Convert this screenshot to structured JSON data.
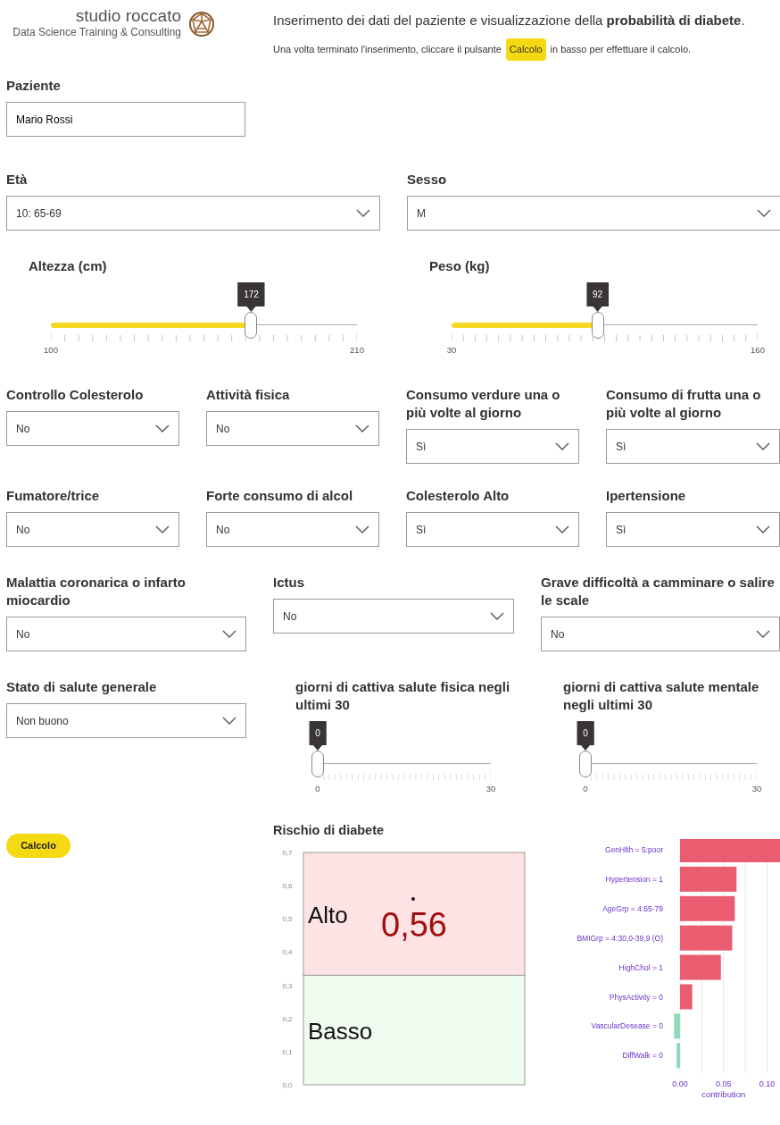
{
  "header": {
    "logo_title": "studio roccato",
    "logo_subtitle": "Data Science Training & Consulting",
    "headline": "Inserimento dei dati del paziente e visualizzazione della **probabilità di diabete**.",
    "instruction_before": "Una volta terminato l'inserimento, cliccare il pulsante",
    "instruction_button": "Calcolo",
    "instruction_after": "in basso per effettuare il calcolo."
  },
  "patient": {
    "label": "Paziente",
    "value": "Mario Rossi"
  },
  "rows": [
    {
      "fields": [
        {
          "kind": "select",
          "label": "Età",
          "value": "10: 65-69"
        },
        {
          "kind": "select",
          "label": "Sesso",
          "value": "M"
        }
      ]
    },
    {
      "fields": [
        {
          "kind": "slider",
          "label": "Altezza (cm)",
          "value": "172",
          "min": "100",
          "max": "210",
          "level": 0.6545
        },
        {
          "kind": "slider",
          "label": "Peso (kg)",
          "value": "92",
          "min": "30",
          "max": "160",
          "level": 0.4769
        }
      ]
    },
    {
      "fields": [
        {
          "kind": "select",
          "label": "Controllo Colesterolo",
          "value": "No"
        },
        {
          "kind": "select",
          "label": "Attività fisica",
          "value": "No"
        },
        {
          "kind": "select",
          "label": "Consumo verdure una o più volte al giorno",
          "value": "Sì"
        },
        {
          "kind": "select",
          "label": "Consumo di frutta una o più volte al giorno",
          "value": "Sì"
        }
      ]
    },
    {
      "fields": [
        {
          "kind": "select",
          "label": "Fumatore/trice",
          "value": "No"
        },
        {
          "kind": "select",
          "label": "Forte consumo di alcol",
          "value": "No"
        },
        {
          "kind": "select",
          "label": "Colesterolo Alto",
          "value": "Sì"
        },
        {
          "kind": "select",
          "label": "Ipertensione",
          "value": "Sì"
        }
      ]
    },
    {
      "fields": [
        {
          "kind": "select",
          "label": "Malattia coronarica o infarto miocardio",
          "value": "No"
        },
        {
          "kind": "select",
          "label": "Ictus",
          "value": "No"
        },
        {
          "kind": "select",
          "label": "Grave difficoltà a camminare o salire le scale",
          "value": "No"
        }
      ]
    },
    {
      "fields": [
        {
          "kind": "select",
          "label": "Stato di salute generale",
          "value": "Non buono"
        },
        {
          "kind": "slider",
          "label": "giorni di cattiva salute fisica negli ultimi 30",
          "value": "0",
          "min": "0",
          "max": "30",
          "level": 0
        },
        {
          "kind": "slider",
          "label": "giorni di cattiva salute mentale negli ultimi 30",
          "value": "0",
          "min": "0",
          "max": "30",
          "level": 0
        }
      ]
    }
  ],
  "calc_button": "Calcolo",
  "result": {
    "title": "Rischio di diabete",
    "risk_chart": {
      "scale_labels": [
        "0,7",
        "0,6",
        "0,5",
        "0,4",
        "0,3",
        "0,2",
        "0,1",
        "0,0"
      ],
      "zones": [
        {
          "label": "Alto",
          "color": "#fde3e3"
        },
        {
          "label": "Basso",
          "color": "#f1fcf0"
        }
      ],
      "value": "0,56"
    },
    "contribution_chart": {
      "chart_data": {
        "type": "bar",
        "orientation": "horizontal",
        "xlabel": "contribution",
        "categories": [
          "GenHlth = 5:poor",
          "Hypertension = 1",
          "AgeGrp = 4:65-79",
          "BMIGrp = 4:30,0-39,9 (O)",
          "HighChol = 1",
          "PhysActivity = 0",
          "VascularDesease = 0",
          "DiffWalk = 0"
        ],
        "stacked": true,
        "grid": true,
        "xlim": [
          -0.007,
          0.115
        ],
        "series": [
          {
            "color": "#ea5c70",
            "values": [
              0.115,
              0.065,
              0.063,
              0.06,
              0.047,
              0.014,
              null,
              null
            ]
          },
          {
            "color": "#8ddbb8",
            "values": [
              null,
              null,
              null,
              null,
              null,
              null,
              -0.007,
              -0.004
            ]
          }
        ],
        "xticks": [
          {
            "value": 0,
            "label": "0.00"
          },
          {
            "value": 0.05,
            "label": "0.05"
          },
          {
            "value": 0.1,
            "label": "0.10"
          }
        ]
      }
    }
  }
}
